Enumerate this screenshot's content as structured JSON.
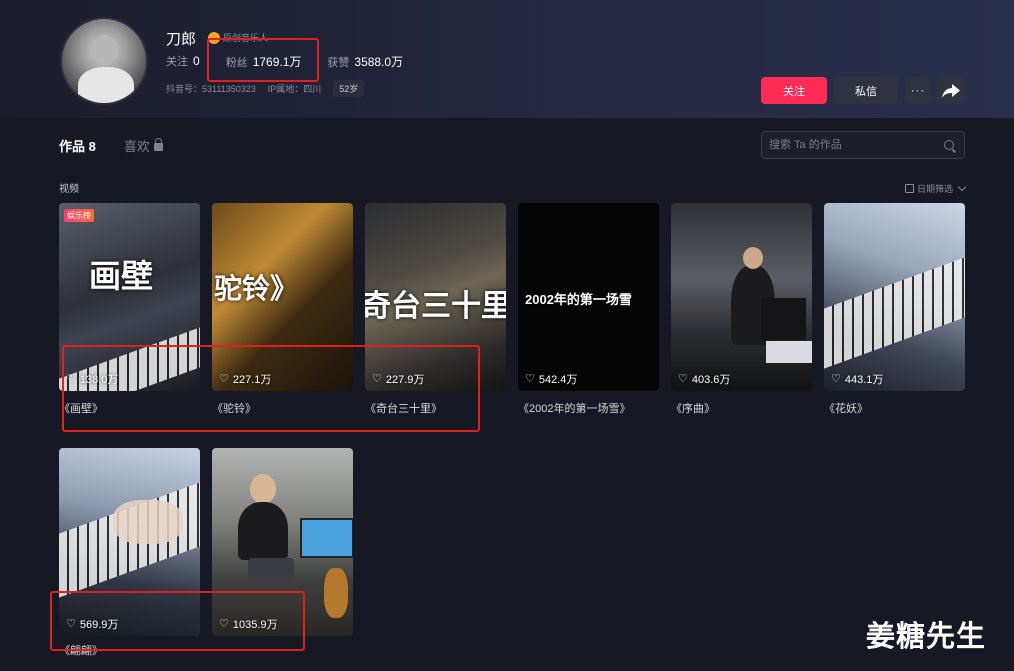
{
  "profile": {
    "name": "刀郎",
    "badge_text": "原创音乐人",
    "stats": [
      {
        "label": "关注",
        "value": "0"
      },
      {
        "label": "粉丝",
        "value": "1769.1万"
      },
      {
        "label": "获赞",
        "value": "3588.0万"
      }
    ],
    "douyin_id": "抖音号：53111350323",
    "ip": "IP属地：四川",
    "age": "52岁"
  },
  "actions": {
    "follow": "关注",
    "message": "私信",
    "more": "···"
  },
  "tabs": {
    "works": "作品 8",
    "likes": "喜欢"
  },
  "search": {
    "placeholder": "搜索 Ta 的作品"
  },
  "section": {
    "label": "视频",
    "filter": "日期筛选"
  },
  "videos": [
    {
      "likes": "138.0万",
      "title": "《画壁》",
      "tag": "娱乐榜",
      "overlay": "画壁"
    },
    {
      "likes": "227.1万",
      "title": "《驼铃》",
      "overlay": "驼铃》"
    },
    {
      "likes": "227.9万",
      "title": "《奇台三十里》",
      "overlay": "奇台三十里"
    },
    {
      "likes": "542.4万",
      "title": "《2002年的第一场雪》",
      "overlay": "2002年的第一场雪"
    },
    {
      "likes": "403.6万",
      "title": "《序曲》"
    },
    {
      "likes": "443.1万",
      "title": "《花妖》"
    },
    {
      "likes": "569.9万",
      "title": "《翩翩》"
    },
    {
      "likes": "1035.9万",
      "title": ""
    }
  ],
  "watermark": "姜糖先生",
  "colors": {
    "accent": "#fe2c55",
    "background": "#161823",
    "highlight_box": "#e02020"
  }
}
